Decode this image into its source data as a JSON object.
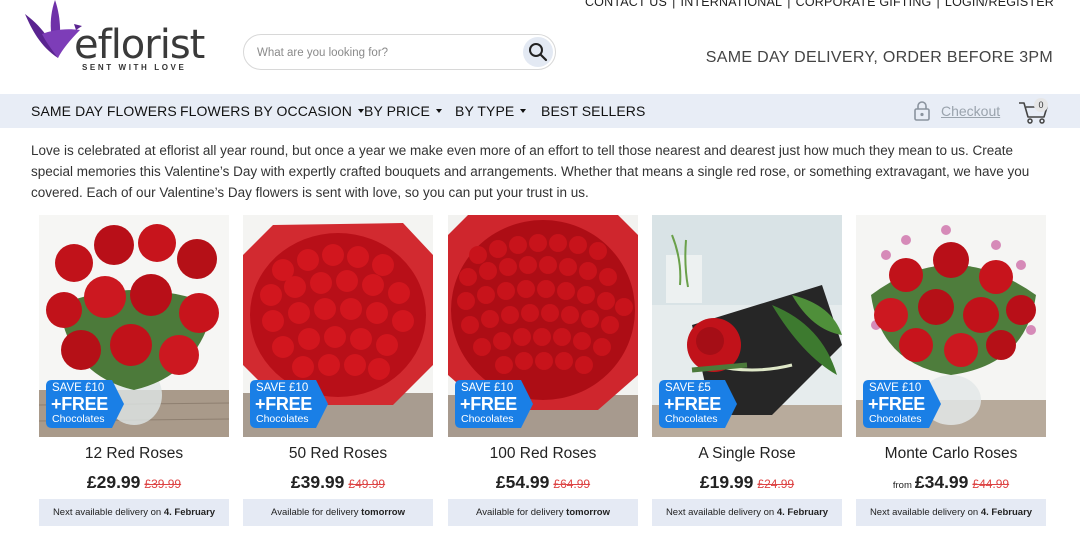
{
  "top_links": [
    "CONTACT US",
    "INTERNATIONAL",
    "CORPORATE GIFTING",
    "LOGIN/REGISTER"
  ],
  "logo": {
    "word": "eflorist",
    "tagline": "SENT WITH LOVE",
    "color": "#6b2fa0"
  },
  "search": {
    "placeholder": "What are you looking for?",
    "value": ""
  },
  "promo": "SAME DAY DELIVERY, ORDER BEFORE 3PM",
  "nav": {
    "items": [
      {
        "label": "SAME DAY FLOWERS",
        "dropdown": false
      },
      {
        "label": "FLOWERS BY OCCASION",
        "dropdown": true
      },
      {
        "label": "BY PRICE",
        "dropdown": true
      },
      {
        "label": "BY TYPE",
        "dropdown": true
      },
      {
        "label": "BEST SELLERS",
        "dropdown": false
      }
    ],
    "checkout_label": "Checkout",
    "cart_count": "0",
    "background": "#e8edf6"
  },
  "intro": "Love is celebrated at eflorist all year round, but once a year we make even more of an effort to tell those nearest and dearest just how much they mean to us. Create special memories this Valentine’s Day with expertly crafted bouquets and arrangements. Whether that means a single red rose, or something extravagant, we have you covered. Each of our Valentine’s Day flowers is sent with love, so you can put your trust in us.",
  "products": [
    {
      "name": "12 Red Roses",
      "from": "",
      "price": "£29.99",
      "was": "£39.99",
      "badge": {
        "save": "SAVE £10",
        "free": "+FREE",
        "gift": "Chocolates"
      },
      "delivery_prefix": "Next available delivery on",
      "delivery_day": "4. February"
    },
    {
      "name": "50 Red Roses",
      "from": "",
      "price": "£39.99",
      "was": "£49.99",
      "badge": {
        "save": "SAVE £10",
        "free": "+FREE",
        "gift": "Chocolates"
      },
      "delivery_prefix": "Available for delivery",
      "delivery_day": "tomorrow"
    },
    {
      "name": "100 Red Roses",
      "from": "",
      "price": "£54.99",
      "was": "£64.99",
      "badge": {
        "save": "SAVE £10",
        "free": "+FREE",
        "gift": "Chocolates"
      },
      "delivery_prefix": "Available for delivery",
      "delivery_day": "tomorrow"
    },
    {
      "name": "A Single Rose",
      "from": "",
      "price": "£19.99",
      "was": "£24.99",
      "badge": {
        "save": "SAVE £5",
        "free": "+FREE",
        "gift": "Chocolates"
      },
      "delivery_prefix": "Next available delivery on",
      "delivery_day": "4. February"
    },
    {
      "name": "Monte Carlo Roses",
      "from": "from",
      "price": "£34.99",
      "was": "£44.99",
      "badge": {
        "save": "SAVE £10",
        "free": "+FREE",
        "gift": "Chocolates"
      },
      "delivery_prefix": "Next available delivery on",
      "delivery_day": "4. February"
    }
  ],
  "colors": {
    "badge_blue": "#1a7fe6",
    "old_price_red": "#d44444",
    "delivery_bg": "#e5eaf4",
    "rose_red": "#c4141b"
  },
  "icons": {
    "search": "search-icon",
    "lock": "padlock-icon",
    "cart": "cart-icon",
    "logo": "bird-logo-icon"
  }
}
